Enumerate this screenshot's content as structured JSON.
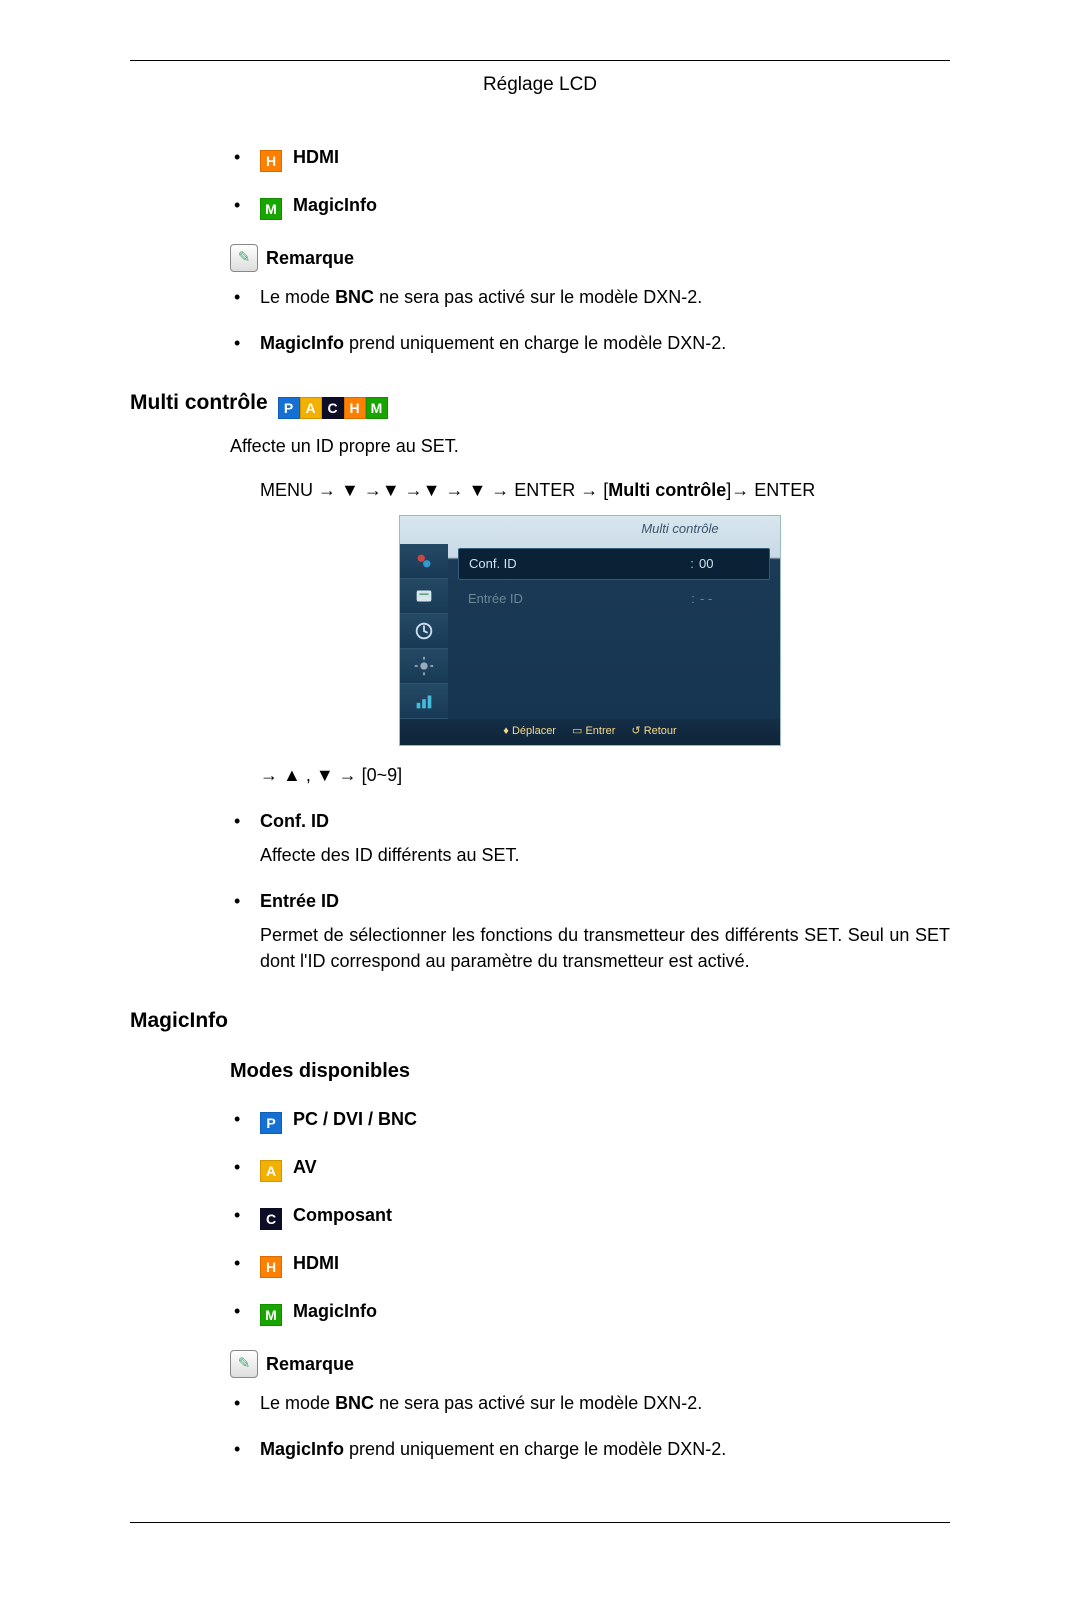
{
  "header": {
    "title": "Réglage LCD"
  },
  "top_modes": [
    {
      "icon": "H",
      "label": "HDMI"
    },
    {
      "icon": "M",
      "label": "MagicInfo"
    }
  ],
  "remark1": {
    "title": "Remarque",
    "items": [
      {
        "pre": "Le mode ",
        "bold": "BNC",
        "post": " ne sera pas activé sur le modèle DXN-2."
      },
      {
        "pre": "",
        "bold": "MagicInfo",
        "post": " prend uniquement en charge le modèle DXN-2."
      }
    ]
  },
  "multi": {
    "heading": "Multi contrôle",
    "intro": "Affecte un ID propre au SET.",
    "nav": {
      "pre": "MENU → ▼ →▼ →▼ → ▼ → ENTER → [",
      "label": "Multi contrôle",
      "post": "]→ ENTER"
    },
    "osd": {
      "title": "Multi contrôle",
      "row1": {
        "label": "Conf. ID",
        "value": "00"
      },
      "row2": {
        "label": "Entrée ID",
        "value": "- -"
      },
      "foot": {
        "a": "Déplacer",
        "b": "Entrer",
        "c": "Retour"
      }
    },
    "arrows": "→ ▲ , ▼ → [0~9]",
    "items": [
      {
        "label": "Conf. ID",
        "desc": "Affecte des ID différents au SET."
      },
      {
        "label": "Entrée ID",
        "desc": "Permet de sélectionner les fonctions du transmetteur des différents SET. Seul un SET dont l'ID correspond au paramètre du transmetteur est activé."
      }
    ]
  },
  "magicinfo": {
    "heading": "MagicInfo",
    "subheading": "Modes disponibles",
    "modes": [
      {
        "icon": "P",
        "label": "PC / DVI / BNC"
      },
      {
        "icon": "A",
        "label": "AV"
      },
      {
        "icon": "C",
        "label": "Composant"
      },
      {
        "icon": "H",
        "label": "HDMI"
      },
      {
        "icon": "M",
        "label": "MagicInfo"
      }
    ],
    "remark": {
      "title": "Remarque",
      "items": [
        {
          "pre": "Le mode ",
          "bold": "BNC",
          "post": " ne sera pas activé sur le modèle DXN-2."
        },
        {
          "pre": "",
          "bold": "MagicInfo",
          "post": " prend uniquement en charge le modèle DXN-2."
        }
      ]
    }
  }
}
